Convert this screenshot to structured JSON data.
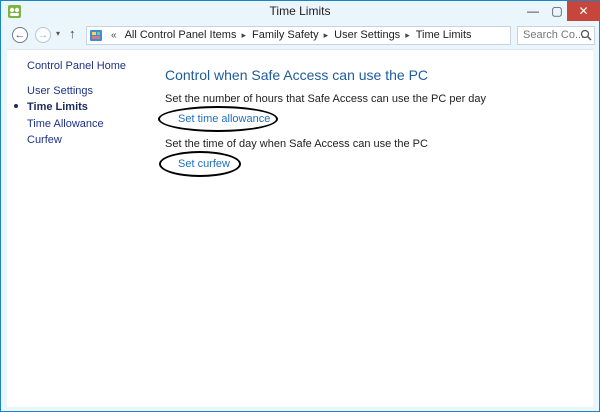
{
  "window": {
    "title": "Time Limits",
    "buttons": {
      "minimize": "—",
      "maximize": "▢",
      "close": "✕"
    }
  },
  "nav": {
    "back_glyph": "←",
    "forward_glyph": "→",
    "recent_glyph": "▾",
    "up_glyph": "↑",
    "address": {
      "lead": "«",
      "crumbs": [
        "All Control Panel Items",
        "Family Safety",
        "User Settings",
        "Time Limits"
      ],
      "separator": "▸",
      "dropdown_glyph": "▾",
      "refresh_glyph": "↻"
    },
    "search_placeholder": "Search Co..."
  },
  "sidebar": {
    "home": "Control Panel Home",
    "items": [
      {
        "label": "User Settings",
        "selected": false
      },
      {
        "label": "Time Limits",
        "selected": true
      },
      {
        "label": "Time Allowance",
        "selected": false
      },
      {
        "label": "Curfew",
        "selected": false
      }
    ]
  },
  "main": {
    "heading": "Control when Safe Access can use the PC",
    "sections": [
      {
        "description": "Set the number of hours that Safe Access can use the PC per day",
        "link": "Set time allowance"
      },
      {
        "description": "Set the time of day when Safe Access can use the PC",
        "link": "Set curfew"
      }
    ]
  },
  "icons": {
    "app": "family-safety-icon",
    "address": "control-panel-icon",
    "search": "magnifier-icon"
  },
  "colors": {
    "accent_link": "#1f6fbf",
    "heading": "#1e5b9c",
    "sidebar_link": "#1e3287",
    "frame": "#1c83c6",
    "close_button": "#c7453a"
  }
}
